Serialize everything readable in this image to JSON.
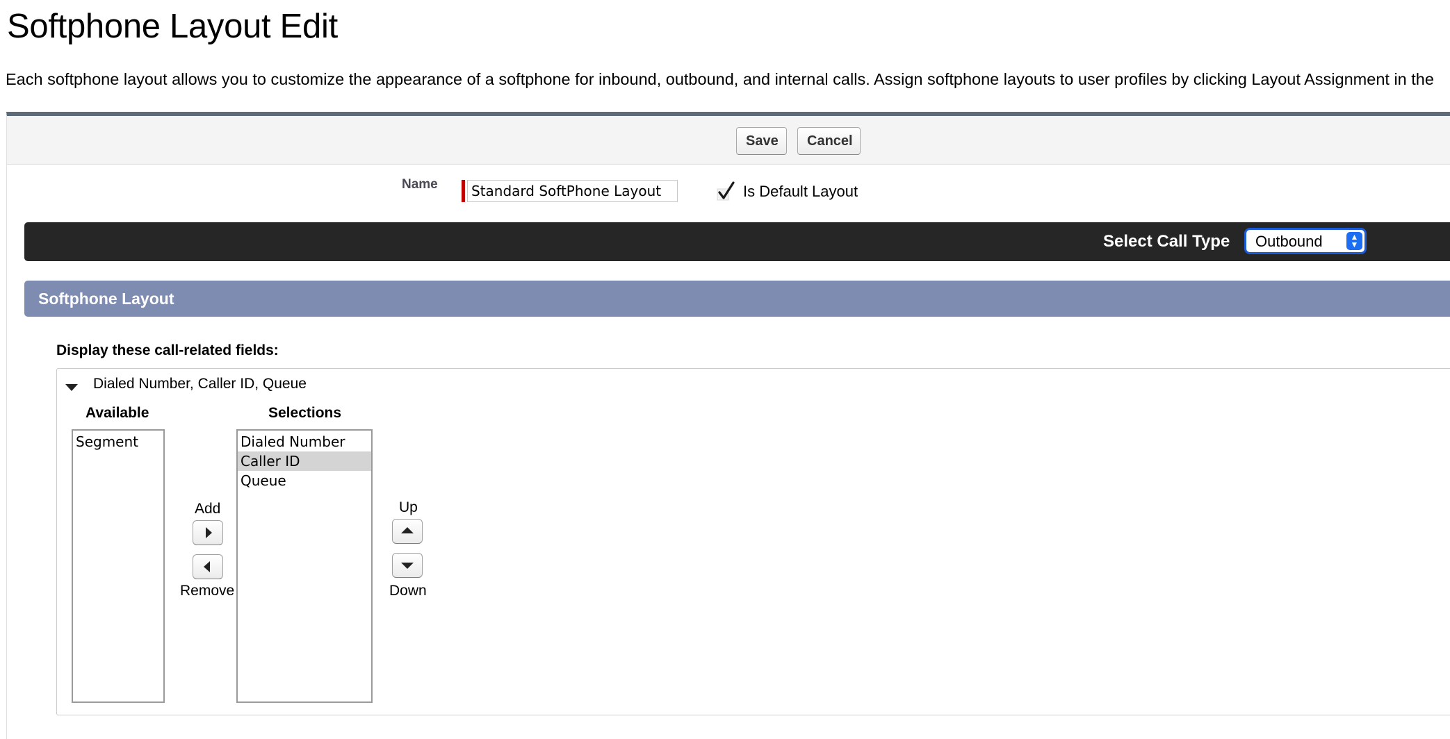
{
  "page": {
    "title": "Softphone Layout Edit",
    "description": "Each softphone layout allows you to customize the appearance of a softphone for inbound, outbound, and internal calls. Assign softphone layouts to user profiles by clicking Layout Assignment in the"
  },
  "toolbar": {
    "save_label": "Save",
    "cancel_label": "Cancel"
  },
  "form": {
    "name_label": "Name",
    "name_value": "Standard SoftPhone Layout",
    "is_default_label": "Is Default Layout",
    "is_default_checked": true
  },
  "call_type": {
    "label": "Select Call Type",
    "selected": "Outbound"
  },
  "section": {
    "title": "Softphone Layout",
    "fields_label": "Display these call-related fields:",
    "group_title": "Dialed Number, Caller ID, Queue",
    "available_header": "Available",
    "selections_header": "Selections",
    "available_items": [
      "Segment"
    ],
    "selection_items": [
      "Dialed Number",
      "Caller ID",
      "Queue"
    ],
    "selected_index": 1,
    "add_label": "Add",
    "remove_label": "Remove",
    "up_label": "Up",
    "down_label": "Down"
  },
  "icons": {
    "checkmark": "checkmark-icon",
    "collapse": "triangle-down-icon",
    "add": "arrow-right-icon",
    "remove": "arrow-left-icon",
    "up": "arrow-up-icon",
    "down": "arrow-down-icon",
    "select": "select-arrows-icon"
  },
  "colors": {
    "panel_border": "#5d6b79",
    "call_type_bar": "#262626",
    "section_header": "#7d8cb0",
    "required": "#c00000",
    "select_accent": "#1c6ef2"
  }
}
